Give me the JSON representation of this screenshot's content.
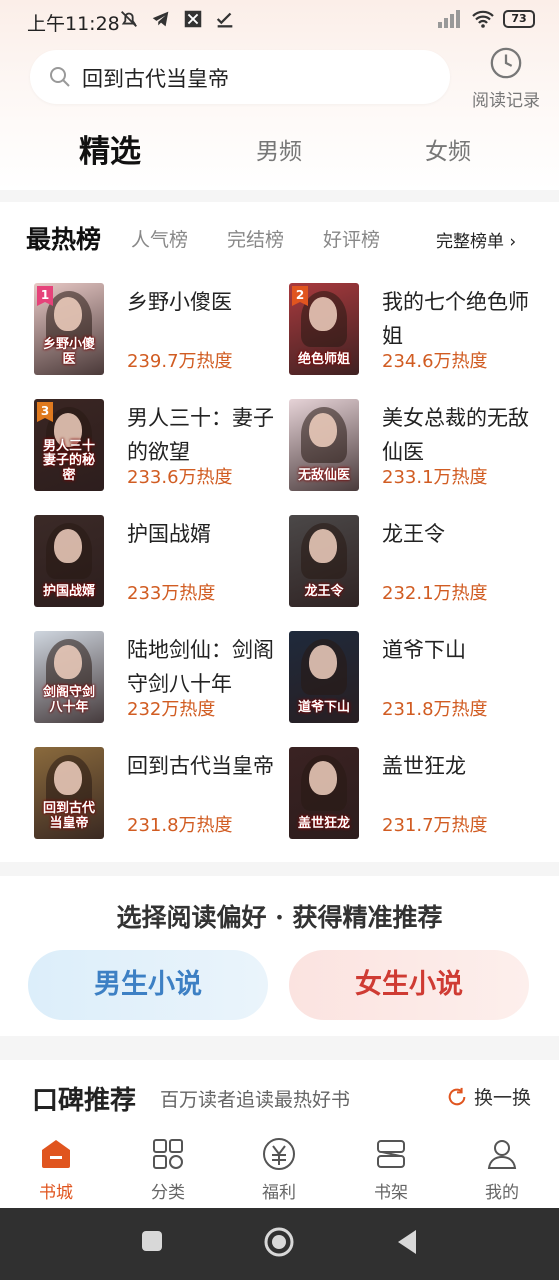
{
  "status_bar": {
    "time": "上午11:28",
    "battery": "73"
  },
  "search": {
    "query": "回到古代当皇帝",
    "history_label": "阅读记录"
  },
  "top_tabs": [
    {
      "label": "精选",
      "active": true
    },
    {
      "label": "男频",
      "active": false
    },
    {
      "label": "女频",
      "active": false
    }
  ],
  "ranking": {
    "tabs": [
      "最热榜",
      "人气榜",
      "完结榜",
      "好评榜"
    ],
    "full_list": "完整榜单",
    "books": [
      {
        "rank": "1",
        "title": "乡野小傻医",
        "heat": "239.7万热度",
        "cover_text": "乡野小傻医",
        "cover_color": "#e8c9c6"
      },
      {
        "rank": "2",
        "title": "我的七个绝色师姐",
        "heat": "234.6万热度",
        "cover_text": "绝色师姐",
        "cover_color": "#a83a3e"
      },
      {
        "rank": "3",
        "title": "男人三十：妻子的欲望",
        "heat": "233.6万热度",
        "cover_text": "男人三十妻子的秘密",
        "cover_color": "#3a2623"
      },
      {
        "rank": "",
        "title": "美女总裁的无敌仙医",
        "heat": "233.1万热度",
        "cover_text": "无敌仙医",
        "cover_color": "#e6d3d7"
      },
      {
        "rank": "",
        "title": "护国战婿",
        "heat": "233万热度",
        "cover_text": "护国战婿",
        "cover_color": "#3b2a27"
      },
      {
        "rank": "",
        "title": "龙王令",
        "heat": "232.1万热度",
        "cover_text": "龙王令",
        "cover_color": "#4b4848"
      },
      {
        "rank": "",
        "title": "陆地剑仙：剑阁守剑八十年",
        "heat": "232万热度",
        "cover_text": "剑阁守剑八十年",
        "cover_color": "#cfd6df"
      },
      {
        "rank": "",
        "title": "道爷下山",
        "heat": "231.8万热度",
        "cover_text": "道爷下山",
        "cover_color": "#1f2a3c"
      },
      {
        "rank": "",
        "title": "回到古代当皇帝",
        "heat": "231.8万热度",
        "cover_text": "回到古代当皇帝",
        "cover_color": "#8a6a3d"
      },
      {
        "rank": "",
        "title": "盖世狂龙",
        "heat": "231.7万热度",
        "cover_text": "盖世狂龙",
        "cover_color": "#3a2222"
      }
    ]
  },
  "preference": {
    "title": "选择阅读偏好 · 获得精准推荐",
    "male": "男生小说",
    "female": "女生小说"
  },
  "praise": {
    "title": "口碑推荐",
    "subtitle": "百万读者追读最热好书",
    "refresh": "换一换"
  },
  "bottom_nav": [
    {
      "label": "书城",
      "icon": "bookstore-icon",
      "active": true
    },
    {
      "label": "分类",
      "icon": "category-icon",
      "active": false
    },
    {
      "label": "福利",
      "icon": "welfare-icon",
      "active": false
    },
    {
      "label": "书架",
      "icon": "bookshelf-icon",
      "active": false
    },
    {
      "label": "我的",
      "icon": "profile-icon",
      "active": false
    }
  ],
  "colors": {
    "accent": "#e0551f",
    "heat": "#d15c22",
    "male_blue": "#3d80c4",
    "female_red": "#cf3b33"
  }
}
